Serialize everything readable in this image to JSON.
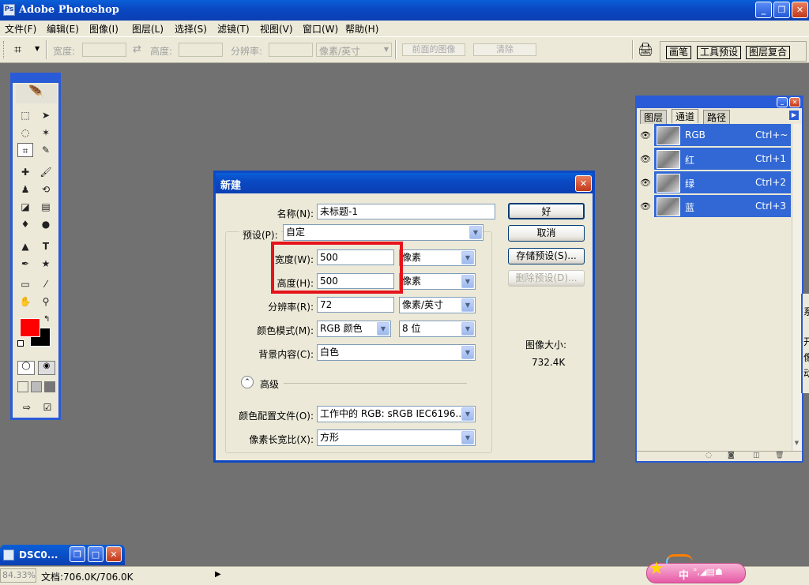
{
  "window": {
    "title": "Adobe Photoshop"
  },
  "menu": [
    "文件(F)",
    "编辑(E)",
    "图像(I)",
    "图层(L)",
    "选择(S)",
    "滤镜(T)",
    "视图(V)",
    "窗口(W)",
    "帮助(H)"
  ],
  "options": {
    "width_label": "宽度:",
    "height_label": "高度:",
    "resolution_label": "分辨率:",
    "unit": "像素/英寸",
    "front_image": "前面的图像",
    "clear": "清除"
  },
  "palette_tabs": [
    "画笔",
    "工具预设",
    "图层复合"
  ],
  "dialog": {
    "title": "新建",
    "name_label": "名称(N):",
    "name_value": "未标题-1",
    "preset_label": "预设(P):",
    "preset_value": "自定",
    "width_label": "宽度(W):",
    "width_value": "500",
    "width_unit": "像素",
    "height_label": "高度(H):",
    "height_value": "500",
    "height_unit": "像素",
    "resolution_label": "分辨率(R):",
    "resolution_value": "72",
    "resolution_unit": "像素/英寸",
    "color_mode_label": "颜色模式(M):",
    "color_mode_value": "RGB 颜色",
    "bit_depth": "8 位",
    "background_label": "背景内容(C):",
    "background_value": "白色",
    "advanced": "高级",
    "profile_label": "颜色配置文件(O):",
    "profile_value": "工作中的 RGB: sRGB IEC6196...",
    "aspect_label": "像素长宽比(X):",
    "aspect_value": "方形",
    "ok": "好",
    "cancel": "取消",
    "save_preset": "存储预设(S)...",
    "delete_preset": "删除预设(D)...",
    "image_size_label": "图像大小:",
    "image_size_value": "732.4K"
  },
  "channels_panel": {
    "tabs": [
      "图层",
      "通道",
      "路径"
    ],
    "rows": [
      {
        "name": "RGB",
        "shortcut": "Ctrl+~"
      },
      {
        "name": "红",
        "shortcut": "Ctrl+1"
      },
      {
        "name": "绿",
        "shortcut": "Ctrl+2"
      },
      {
        "name": "蓝",
        "shortcut": "Ctrl+3"
      }
    ]
  },
  "partial_panel_text": [
    "系",
    "开",
    "像",
    "动"
  ],
  "minimized_doc": {
    "title": "DSC0..."
  },
  "status": {
    "zoom": "84.33%",
    "doc": "文档:706.0K/706.0K"
  },
  "ime": {
    "label": "中"
  },
  "colors": {
    "foreground": "#ff0000",
    "background": "#000000",
    "highlight": "#e5141b",
    "selection": "#3168d5"
  }
}
